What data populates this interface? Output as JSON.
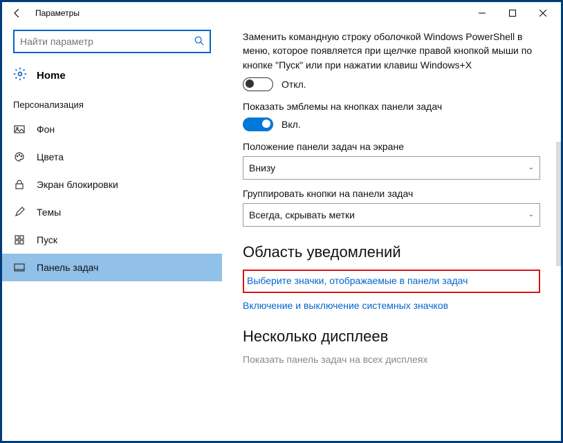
{
  "window": {
    "title": "Параметры"
  },
  "sidebar": {
    "search_placeholder": "Найти параметр",
    "home_label": "Home",
    "section_label": "Персонализация",
    "items": [
      {
        "label": "Фон"
      },
      {
        "label": "Цвета"
      },
      {
        "label": "Экран блокировки"
      },
      {
        "label": "Темы"
      },
      {
        "label": "Пуск"
      },
      {
        "label": "Панель задач"
      }
    ],
    "selected_index": 5
  },
  "content": {
    "powershell_desc": "Заменить командную строку оболочкой Windows PowerShell в меню, которое появляется при щелчке правой кнопкой мыши по кнопке \"Пуск\" или при нажатии клавиш Windows+X",
    "toggle_off_label": "Откл.",
    "badges_label": "Показать эмблемы на кнопках панели задач",
    "toggle_on_label": "Вкл.",
    "position_label": "Положение панели задач на экране",
    "position_value": "Внизу",
    "group_label": "Группировать кнопки на панели задач",
    "group_value": "Всегда, скрывать метки",
    "notification_heading": "Область уведомлений",
    "link_select_icons": "Выберите значки, отображаемые в панели задач",
    "link_system_icons": "Включение и выключение системных значков",
    "multi_heading": "Несколько дисплеев",
    "multi_sub": "Показать панель задач на всех дисплеях"
  }
}
